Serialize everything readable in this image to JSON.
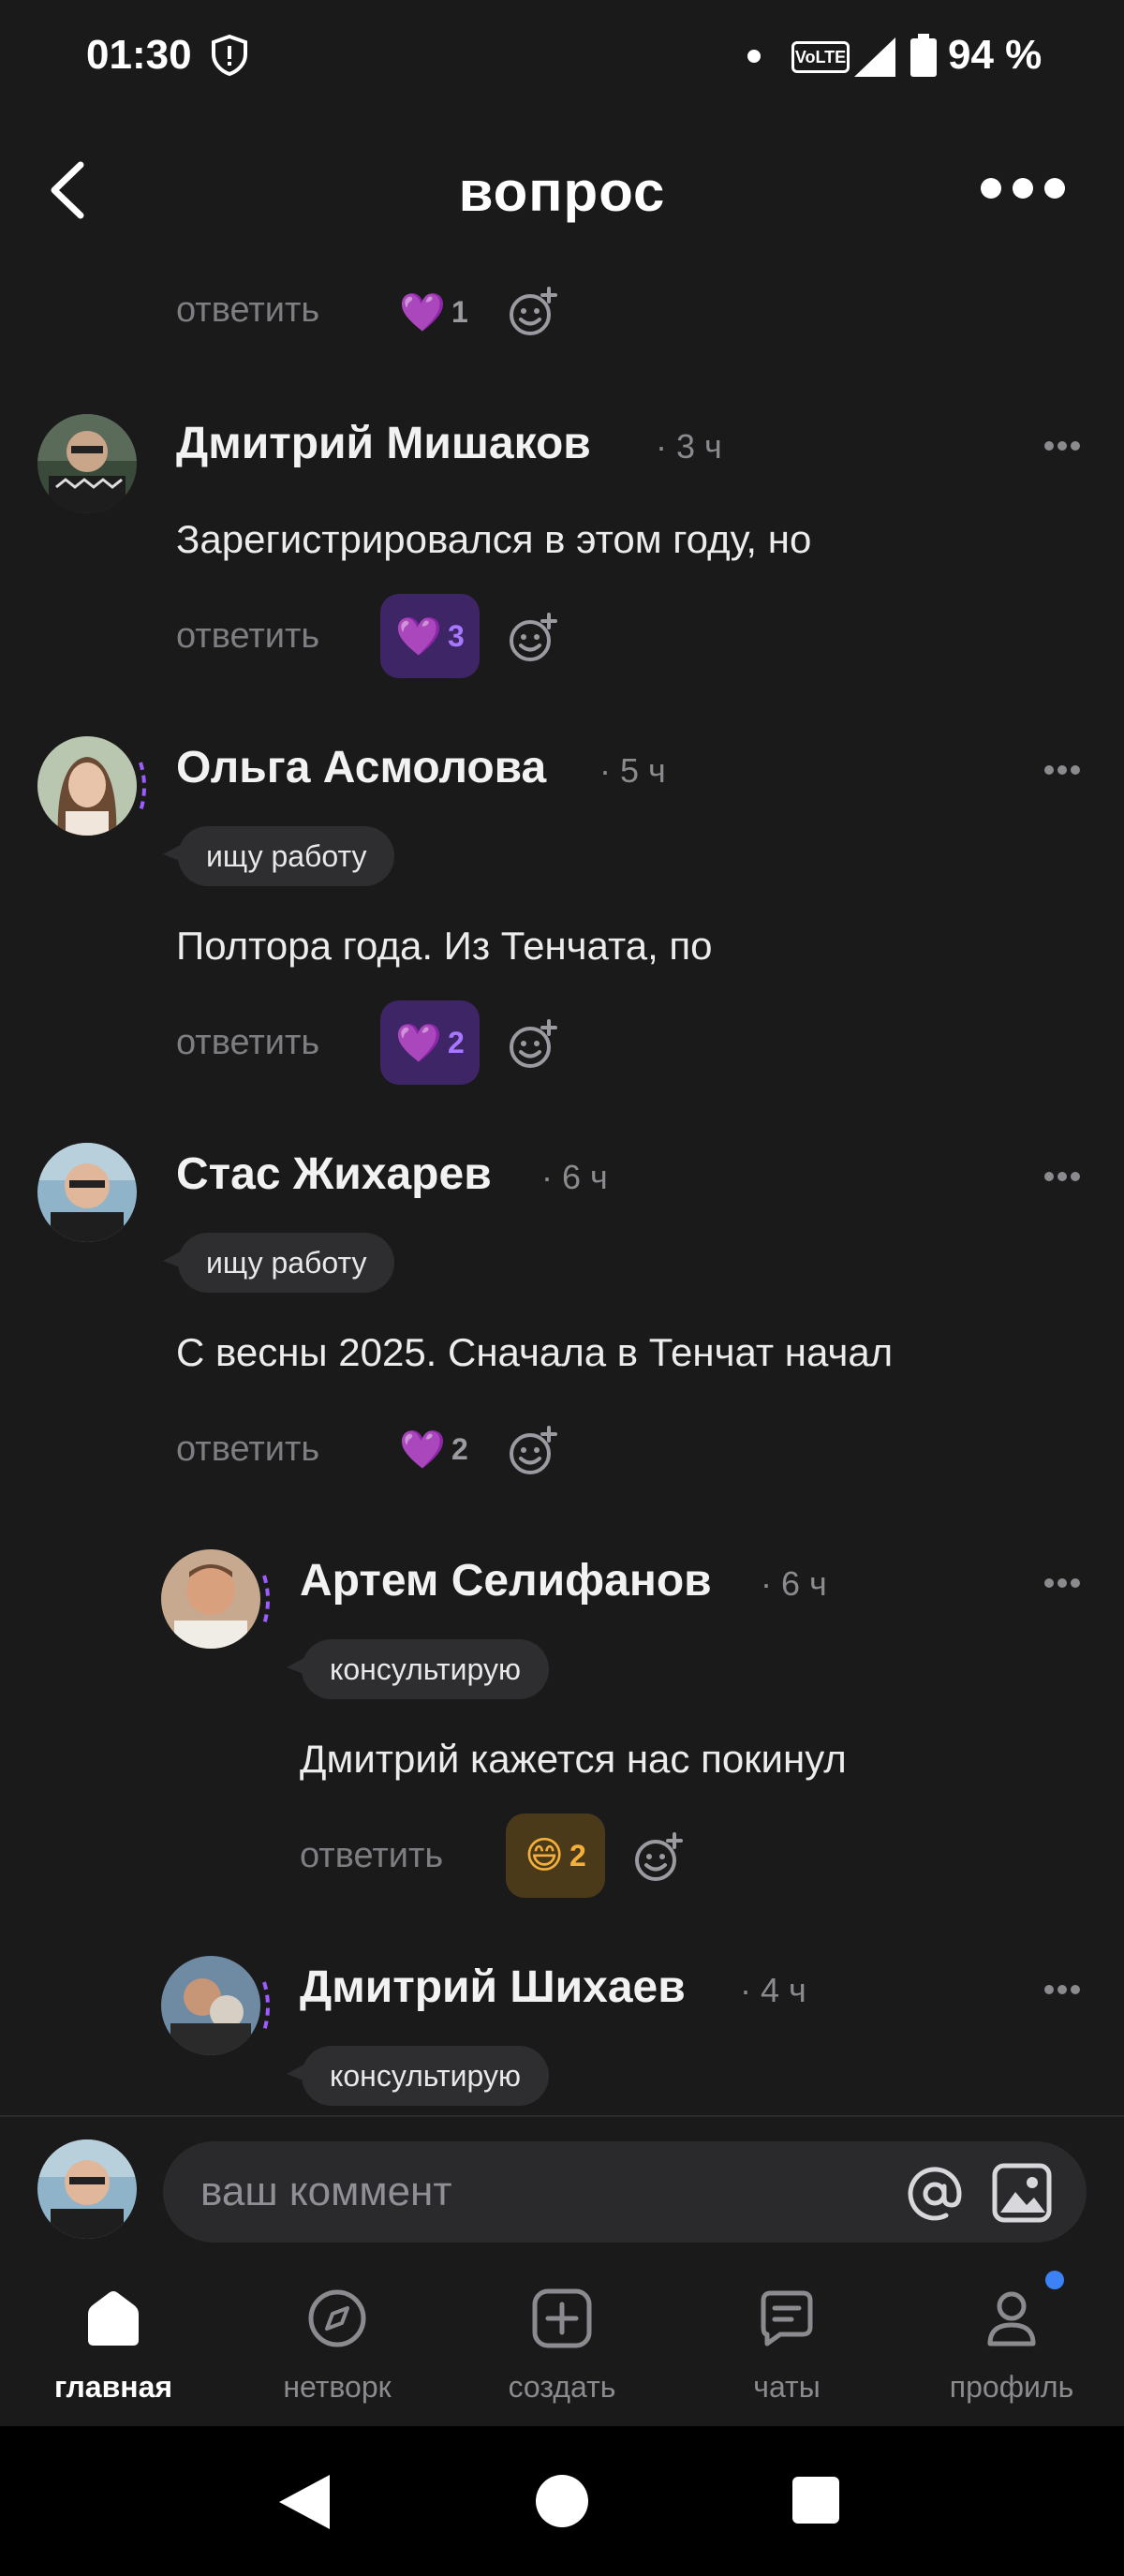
{
  "status_bar": {
    "time": "01:30",
    "volte": "VoLTE",
    "battery": "94 %"
  },
  "header": {
    "title": "вопрос"
  },
  "prev_comment": {
    "reply_label": "ответить",
    "reaction_count": "1"
  },
  "comments": [
    {
      "author": "Дмитрий Мишаков",
      "time": "· 3 ч",
      "tag": "",
      "text": "Зарегистрировался в этом году, но",
      "reply_label": "ответить",
      "reaction_count": "3"
    },
    {
      "author": "Ольга Асмолова",
      "time": "· 5 ч",
      "tag": "ищу работу",
      "text": "Полтора года. Из Тенчата, по",
      "reply_label": "ответить",
      "reaction_count": "2"
    },
    {
      "author": "Стас Жихарев",
      "time": "· 6 ч",
      "tag": "ищу работу",
      "text": "С весны 2025. Сначала в Тенчат начал",
      "reply_label": "ответить",
      "reaction_count": "2"
    },
    {
      "author": "Артем Селифанов",
      "time": "· 6 ч",
      "tag": "консультирую",
      "text": "Дмитрий кажется нас покинул",
      "reply_label": "ответить",
      "reaction_count": "2"
    },
    {
      "author": "Дмитрий Шихаев",
      "time": "· 4 ч",
      "tag": "консультирую"
    }
  ],
  "comment_input": {
    "placeholder": "ваш коммент"
  },
  "bottom_nav": {
    "items": [
      {
        "label": "главная"
      },
      {
        "label": "нетворк"
      },
      {
        "label": "создать"
      },
      {
        "label": "чаты"
      },
      {
        "label": "профиль"
      }
    ]
  },
  "colors": {
    "background": "#1a1a1b",
    "accent_purple": "#a777ff",
    "reaction_bg": "#3d2566",
    "notification": "#3b82f6"
  }
}
